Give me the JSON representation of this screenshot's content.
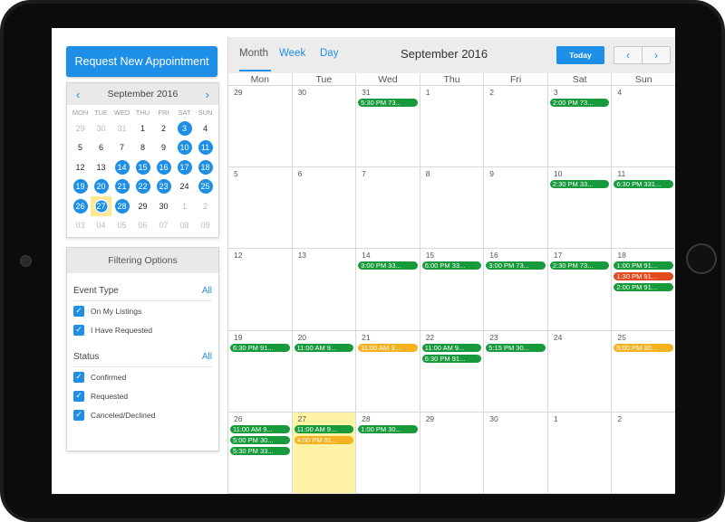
{
  "left": {
    "request_button": "Request New Appointment",
    "mini_calendar": {
      "title": "September 2016",
      "prev_icon": "chevron-left",
      "next_icon": "chevron-right",
      "weekdays": [
        "MON",
        "TUE",
        "WED",
        "THU",
        "FRI",
        "SAT",
        "SUN"
      ],
      "days": [
        {
          "n": "29",
          "other": true
        },
        {
          "n": "30",
          "other": true
        },
        {
          "n": "31",
          "other": true
        },
        {
          "n": "1"
        },
        {
          "n": "2"
        },
        {
          "n": "3",
          "has": true
        },
        {
          "n": "4"
        },
        {
          "n": "5"
        },
        {
          "n": "6"
        },
        {
          "n": "7"
        },
        {
          "n": "8"
        },
        {
          "n": "9"
        },
        {
          "n": "10",
          "has": true
        },
        {
          "n": "11",
          "has": true
        },
        {
          "n": "12"
        },
        {
          "n": "13"
        },
        {
          "n": "14",
          "has": true
        },
        {
          "n": "15",
          "has": true
        },
        {
          "n": "16",
          "has": true
        },
        {
          "n": "17",
          "has": true
        },
        {
          "n": "18",
          "has": true
        },
        {
          "n": "19",
          "has": true
        },
        {
          "n": "20",
          "has": true
        },
        {
          "n": "21",
          "has": true
        },
        {
          "n": "22",
          "has": true
        },
        {
          "n": "23",
          "has": true
        },
        {
          "n": "24"
        },
        {
          "n": "25",
          "has": true
        },
        {
          "n": "26",
          "has": true
        },
        {
          "n": "27",
          "has": true,
          "today": true
        },
        {
          "n": "28",
          "has": true
        },
        {
          "n": "29"
        },
        {
          "n": "30"
        },
        {
          "n": "1",
          "other": true
        },
        {
          "n": "2",
          "other": true
        },
        {
          "n": "03",
          "other": true
        },
        {
          "n": "04",
          "other": true
        },
        {
          "n": "05",
          "other": true
        },
        {
          "n": "06",
          "other": true
        },
        {
          "n": "07",
          "other": true
        },
        {
          "n": "08",
          "other": true
        },
        {
          "n": "09",
          "other": true
        }
      ]
    },
    "filter": {
      "title": "Filtering Options",
      "event_type": {
        "label": "Event Type",
        "all": "All",
        "items": [
          "On My Listings",
          "I Have Requested"
        ]
      },
      "status": {
        "label": "Status",
        "all": "All",
        "items": [
          "Confirmed",
          "Requested",
          "Canceled/Declined"
        ]
      }
    }
  },
  "main": {
    "tabs": {
      "month": "Month",
      "week": "Week",
      "day": "Day"
    },
    "title": "September 2016",
    "today": "Today",
    "prev_icon": "‹",
    "next_icon": "›",
    "weekdays": [
      "Mon",
      "Tue",
      "Wed",
      "Thu",
      "Fri",
      "Sat",
      "Sun"
    ],
    "colors": {
      "confirmed": "#169a3b",
      "requested": "#f4b221",
      "declined": "#e24b1d",
      "accent": "#1e8fe6",
      "today_bg": "#fff4a6"
    },
    "cells": [
      {
        "n": "29",
        "events": []
      },
      {
        "n": "30",
        "events": []
      },
      {
        "n": "31",
        "events": [
          {
            "t": "5:30 PM 73...",
            "c": "green"
          }
        ]
      },
      {
        "n": "1",
        "events": []
      },
      {
        "n": "2",
        "events": []
      },
      {
        "n": "3",
        "events": [
          {
            "t": "2:00 PM 73...",
            "c": "green"
          }
        ]
      },
      {
        "n": "4",
        "events": []
      },
      {
        "n": "5",
        "events": []
      },
      {
        "n": "6",
        "events": []
      },
      {
        "n": "7",
        "events": []
      },
      {
        "n": "8",
        "events": []
      },
      {
        "n": "9",
        "events": []
      },
      {
        "n": "10",
        "events": [
          {
            "t": "2:30 PM 33...",
            "c": "green"
          }
        ]
      },
      {
        "n": "11",
        "events": [
          {
            "t": "6:30 PM 331...",
            "c": "green"
          }
        ]
      },
      {
        "n": "12",
        "events": []
      },
      {
        "n": "13",
        "events": []
      },
      {
        "n": "14",
        "events": [
          {
            "t": "3:00 PM 33...",
            "c": "green"
          }
        ]
      },
      {
        "n": "15",
        "events": [
          {
            "t": "6:00 PM 33...",
            "c": "green"
          }
        ]
      },
      {
        "n": "16",
        "events": [
          {
            "t": "3:00 PM 73...",
            "c": "green"
          }
        ]
      },
      {
        "n": "17",
        "events": [
          {
            "t": "2:30 PM 73...",
            "c": "green"
          }
        ]
      },
      {
        "n": "18",
        "events": [
          {
            "t": "1:00 PM 91...",
            "c": "green"
          },
          {
            "t": "1:30 PM 91...",
            "c": "red"
          },
          {
            "t": "2:00 PM 91...",
            "c": "green"
          }
        ]
      },
      {
        "n": "19",
        "events": [
          {
            "t": "6:30 PM 91...",
            "c": "green"
          }
        ]
      },
      {
        "n": "20",
        "events": [
          {
            "t": "11:00 AM 9...",
            "c": "green"
          }
        ]
      },
      {
        "n": "21",
        "events": [
          {
            "t": "11:00 AM 3...",
            "c": "orange"
          }
        ]
      },
      {
        "n": "22",
        "events": [
          {
            "t": "11:00 AM 9...",
            "c": "green"
          },
          {
            "t": "6:30 PM 91...",
            "c": "green"
          }
        ]
      },
      {
        "n": "23",
        "events": [
          {
            "t": "5:15 PM 30...",
            "c": "green"
          }
        ]
      },
      {
        "n": "24",
        "events": []
      },
      {
        "n": "25",
        "events": [
          {
            "t": "5:00 PM 30...",
            "c": "orange"
          }
        ]
      },
      {
        "n": "26",
        "events": [
          {
            "t": "11:00 AM 9...",
            "c": "green"
          },
          {
            "t": "5:00 PM 30...",
            "c": "green"
          },
          {
            "t": "5:30 PM 33...",
            "c": "green"
          }
        ]
      },
      {
        "n": "27",
        "today": true,
        "events": [
          {
            "t": "11:00 AM 9...",
            "c": "green"
          },
          {
            "t": "4:00 PM 91...",
            "c": "orange"
          }
        ]
      },
      {
        "n": "28",
        "events": [
          {
            "t": "1:00 PM 30...",
            "c": "green"
          }
        ]
      },
      {
        "n": "29",
        "events": []
      },
      {
        "n": "30",
        "events": []
      },
      {
        "n": "1",
        "events": []
      },
      {
        "n": "2",
        "events": []
      }
    ]
  }
}
